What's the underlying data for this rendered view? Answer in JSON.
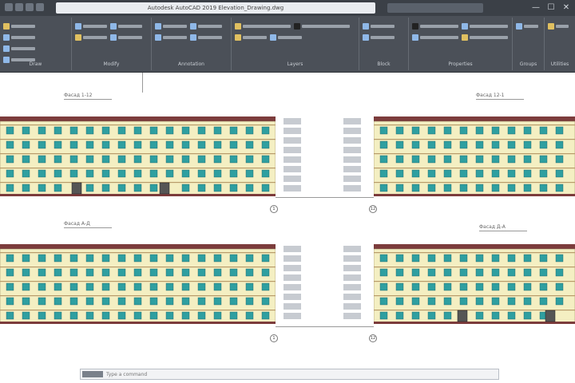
{
  "window": {
    "title": "Autodesk AutoCAD 2019   Elevation_Drawing.dwg",
    "buttons": {
      "minimize": "—",
      "maximize": "☐",
      "close": "✕"
    }
  },
  "ribbon": {
    "panels": [
      {
        "label": "Draw"
      },
      {
        "label": "Modify"
      },
      {
        "label": "Annotation"
      },
      {
        "label": "Layers"
      },
      {
        "label": "Block"
      },
      {
        "label": "Properties"
      },
      {
        "label": "Groups"
      },
      {
        "label": "Utilities"
      }
    ]
  },
  "drawing": {
    "views": [
      {
        "label": "Фасад 1-12"
      },
      {
        "label": "Фасад 12-1"
      },
      {
        "label": "Фасад А-Д"
      },
      {
        "label": "Фасад Д-А"
      }
    ],
    "axis_marks": [
      "1",
      "12",
      "1",
      "12"
    ]
  },
  "command": {
    "placeholder": "Type a command"
  },
  "colors": {
    "wall": "#f4efc2",
    "roof": "#7c3c3c",
    "window": "#2f9fa0",
    "ribbon": "#4b5058"
  }
}
